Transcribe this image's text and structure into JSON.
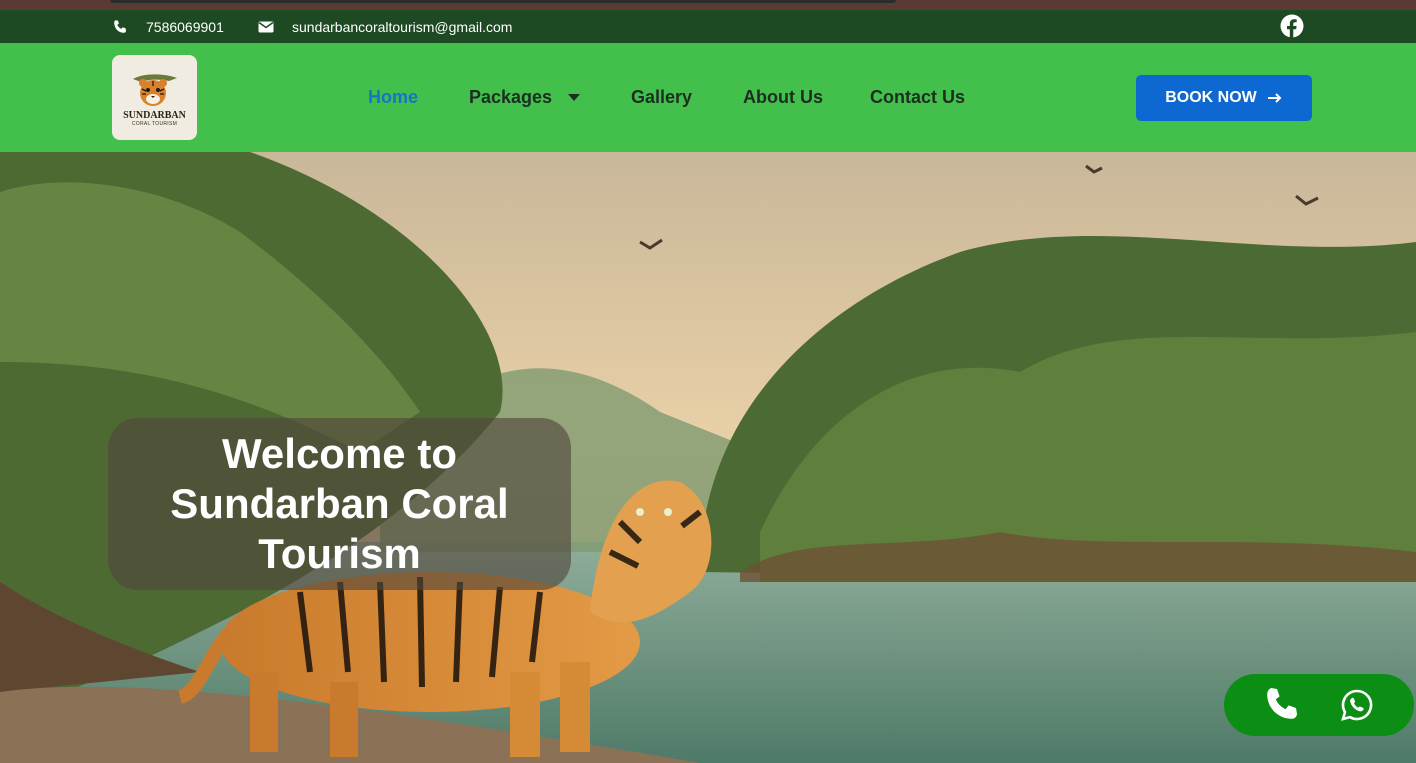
{
  "contact": {
    "phone": "7586069901",
    "email": "sundarbancoraltourism@gmail.com",
    "phone_icon": "phone-icon",
    "email_icon": "envelope-icon",
    "social_icon": "facebook-icon"
  },
  "brand": {
    "name": "SUNDARBAN",
    "tagline": "CORAL TOURISM"
  },
  "nav": {
    "items": [
      {
        "label": "Home",
        "active": true
      },
      {
        "label": "Packages",
        "has_dropdown": true
      },
      {
        "label": "Gallery"
      },
      {
        "label": "About Us"
      },
      {
        "label": "Contact Us"
      }
    ]
  },
  "cta": {
    "label": "BOOK NOW"
  },
  "hero": {
    "line1": "Welcome to",
    "line2": "Sundarban Coral",
    "line3": "Tourism"
  },
  "floating": {
    "call_icon": "phone-call-icon",
    "whatsapp_icon": "whatsapp-icon"
  },
  "colors": {
    "topbar": "#1d4a22",
    "navbar": "#43bf4c",
    "active_link": "#1476c8",
    "cta": "#0d68d1",
    "float": "#0b8e13"
  }
}
